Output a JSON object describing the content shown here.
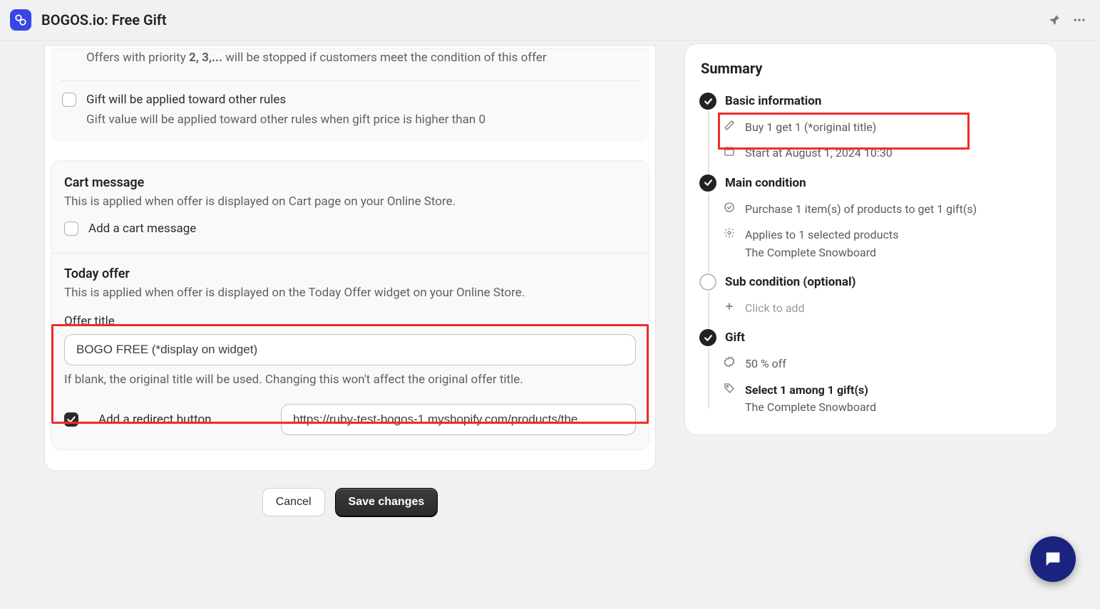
{
  "app_title": "BOGOS.io: Free Gift",
  "priority_pre": "Offers with priority ",
  "priority_bold": "2, 3,...",
  "priority_post": " will be stopped if customers meet the condition of this offer",
  "apply_toward_label": "Gift will be applied toward other rules",
  "apply_toward_desc": "Gift value will be applied toward other rules when gift price is higher than 0",
  "cart_msg_title": "Cart message",
  "cart_msg_desc": "This is applied when offer is displayed on Cart page on your Online Store.",
  "cart_msg_check_label": "Add a cart message",
  "today_title": "Today offer",
  "today_desc": "This is applied when offer is displayed on the Today Offer widget on your Online Store.",
  "offer_title_label": "Offer title",
  "offer_title_value": "BOGO FREE (*display on widget)",
  "offer_title_helper": "If blank, the original title will be used. Changing this won't affect the original offer title.",
  "redirect_label": "Add a redirect button",
  "redirect_url": "https://ruby-test-bogos-1.myshopify.com/products/the",
  "cancel_btn": "Cancel",
  "save_btn": "Save changes",
  "summary_title": "Summary",
  "s_basic": "Basic information",
  "s_basic_name": "Buy 1 get 1 (*original title)",
  "s_basic_start": "Start at August 1, 2024 10:30",
  "s_main": "Main condition",
  "s_main_cond": "Purchase 1 item(s) of products to get 1 gift(s)",
  "s_main_applies": "Applies to 1 selected products",
  "s_main_product": "The Complete Snowboard",
  "s_sub": "Sub condition (optional)",
  "s_sub_add": "Click to add",
  "s_gift": "Gift",
  "s_gift_pct": "50 % off",
  "s_gift_select": "Select 1 among 1 gift(s)",
  "s_gift_product": "The Complete Snowboard"
}
